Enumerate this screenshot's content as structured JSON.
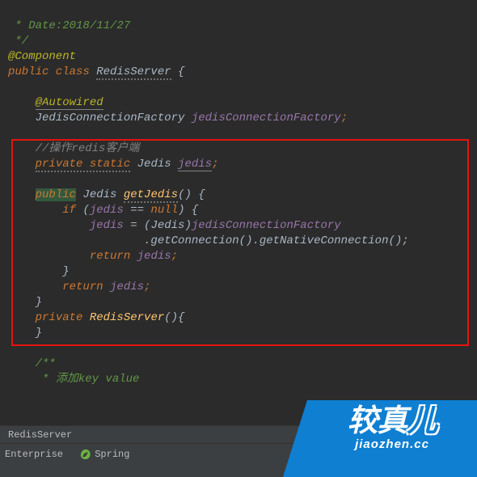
{
  "code": {
    "l1a": " * Date:",
    "l1b": "2018/11/27",
    "l2": " */",
    "l3": "@Component",
    "l4_kw1": "public class ",
    "l4_cls": "RedisServer",
    "l4_brace": " {",
    "l6_ann": "@Autowired",
    "l7_type": "JedisConnectionFactory ",
    "l7_id": "jedisConnectionFactory",
    "l7_semi": ";",
    "l9_c": "//操作redis客户端",
    "l10_kw": "private static",
    "l10_sp": " Jedis ",
    "l10_id": "jedis",
    "l10_semi": ";",
    "l12_kw": "public",
    "l12_sp": " Jedis ",
    "l12_m": "getJedis",
    "l12_rest": "() {",
    "l13_kw": "if ",
    "l13_a": "(",
    "l13_id": "jedis ",
    "l13_b": "== ",
    "l13_kwn": "null",
    "l13_c": ") {",
    "l14_id": "jedis ",
    "l14_a": "= (Jedis)",
    "l14_id2": "jedisConnectionFactory",
    "l15_a": ".getConnection().getNativeConnection();",
    "l16_kw": "return ",
    "l16_id": "jedis",
    "l16_s": ";",
    "l17": "}",
    "l18_kw": "return ",
    "l18_id": "jedis",
    "l18_s": ";",
    "l19": "}",
    "l20_kw": "private ",
    "l20_m": "RedisServer",
    "l20_rest": "(){",
    "l21": "}",
    "l23": "/**",
    "l24": " * 添加key value"
  },
  "breadcrumb": "RedisServer",
  "status": {
    "enterprise": "Enterprise",
    "spring": "Spring"
  },
  "logo": {
    "cn1": "较真",
    "cn2": "儿",
    "en": "jiaozhen.cc"
  }
}
